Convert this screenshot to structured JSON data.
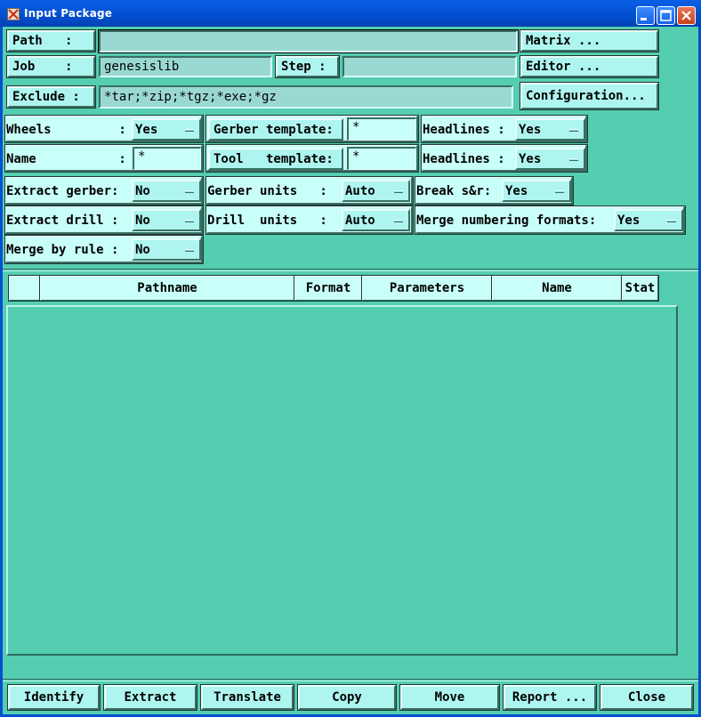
{
  "window": {
    "title": "Input Package"
  },
  "path": {
    "label": "Path   :",
    "value": ""
  },
  "job": {
    "label": "Job    :",
    "value": "genesislib"
  },
  "step": {
    "label": "Step :",
    "value": ""
  },
  "exclude": {
    "label": "Exclude :",
    "value": "*tar;*zip;*tgz;*exe;*gz"
  },
  "side_buttons": {
    "matrix": "Matrix ...",
    "editor": "Editor ...",
    "configuration": "Configuration..."
  },
  "options": {
    "wheels": {
      "label": "Wheels         :",
      "value": "Yes"
    },
    "name": {
      "label": "Name           :",
      "value": "*"
    },
    "extract_gerber": {
      "label": "Extract gerber:",
      "value": "No"
    },
    "extract_drill": {
      "label": "Extract drill :",
      "value": "No"
    },
    "merge_by_rule": {
      "label": "Merge by rule :",
      "value": "No"
    },
    "gerber_template": {
      "label": "Gerber template:",
      "value": "*"
    },
    "tool_template": {
      "label": "Tool   template:",
      "value": "*"
    },
    "gerber_units": {
      "label": "Gerber units   :",
      "value": "Auto"
    },
    "drill_units": {
      "label": "Drill  units   :",
      "value": "Auto"
    },
    "headlines_1": {
      "label": "Headlines :",
      "value": "Yes"
    },
    "headlines_2": {
      "label": "Headlines :",
      "value": "Yes"
    },
    "break_sr": {
      "label": "Break s&r:",
      "value": "Yes"
    },
    "merge_numbering": {
      "label": "Merge numbering formats:",
      "value": "Yes"
    }
  },
  "table": {
    "columns": [
      "",
      "Pathname",
      "Format",
      "Parameters",
      "Name",
      "Stat"
    ],
    "rows": []
  },
  "bottom_buttons": {
    "identify": "Identify",
    "extract": "Extract",
    "translate": "Translate",
    "copy": "Copy",
    "move": "Move",
    "report": "Report ...",
    "close": "Close"
  }
}
